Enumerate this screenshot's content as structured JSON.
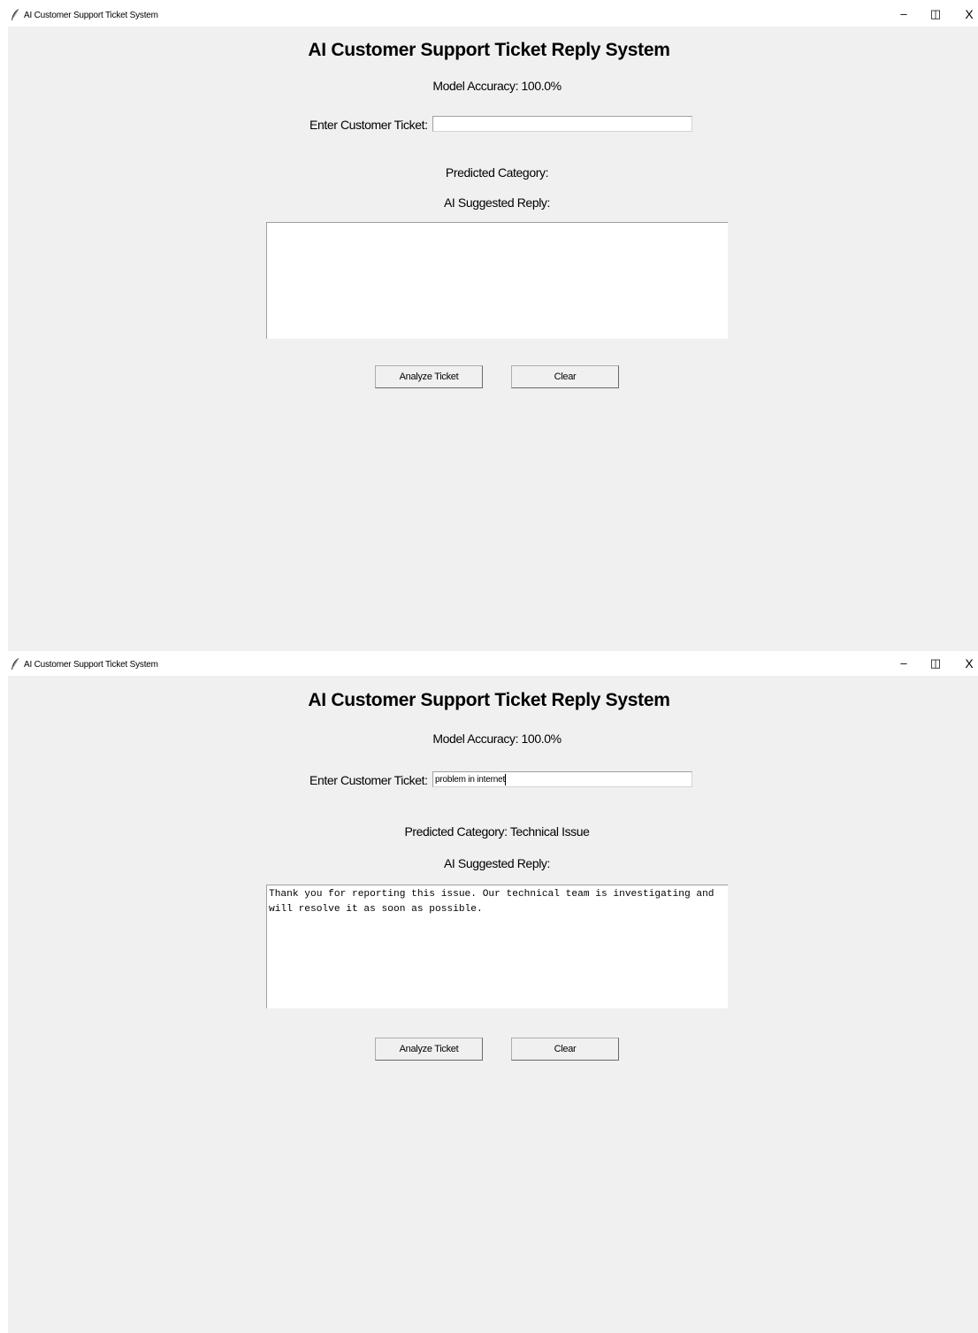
{
  "windows": [
    {
      "title": "AI Customer Support Ticket System",
      "controls": {
        "minimize": "–",
        "maximize": "◫",
        "close": "X"
      },
      "heading": "AI Customer Support Ticket Reply System",
      "accuracy": "Model Accuracy: 100.0%",
      "ticket_label": "Enter Customer Ticket:",
      "ticket_value": "",
      "predicted": "Predicted Category:",
      "reply_label": "AI Suggested Reply:",
      "reply_text": "",
      "analyze_button": "Analyze Ticket",
      "clear_button": "Clear"
    },
    {
      "title": "AI Customer Support Ticket System",
      "controls": {
        "minimize": "–",
        "maximize": "◫",
        "close": "X"
      },
      "heading": "AI Customer Support Ticket Reply System",
      "accuracy": "Model Accuracy: 100.0%",
      "ticket_label": "Enter Customer Ticket:",
      "ticket_value": "problem in internet",
      "predicted": "Predicted Category: Technical Issue",
      "reply_label": "AI Suggested Reply:",
      "reply_text": "Thank you for reporting this issue. Our technical team is investigating and will resolve it as soon as possible.",
      "analyze_button": "Analyze Ticket",
      "clear_button": "Clear"
    }
  ]
}
